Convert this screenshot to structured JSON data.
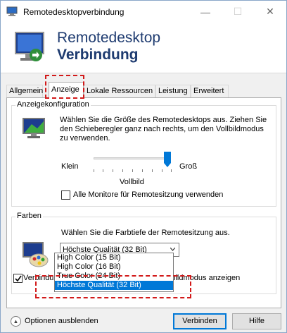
{
  "window": {
    "title": "Remotedesktopverbindung",
    "minimize": "—",
    "maximize": "☐",
    "close": "✕"
  },
  "banner": {
    "line1": "Remotedesktop",
    "line2": "Verbindung"
  },
  "tabs": [
    {
      "label": "Allgemein",
      "active": false
    },
    {
      "label": "Anzeige",
      "active": true
    },
    {
      "label": "Lokale Ressourcen",
      "active": false
    },
    {
      "label": "Leistung",
      "active": false
    },
    {
      "label": "Erweitert",
      "active": false
    }
  ],
  "display_config": {
    "legend": "Anzeigekonfiguration",
    "description": "Wählen Sie die Größe des Remotedesktops aus. Ziehen Sie den Schieberegler ganz nach rechts, um den Vollbildmodus zu verwenden.",
    "small_label": "Klein",
    "large_label": "Groß",
    "slider_value_label": "Vollbild",
    "slider_level": 1.0,
    "all_monitors_label": "Alle Monitore für Remotesitzung verwenden",
    "all_monitors_checked": false
  },
  "colors": {
    "legend": "Farben",
    "description": "Wählen Sie die Farbtiefe der Remotesitzung aus.",
    "selected_value": "Höchste Qualität (32 Bit)",
    "options": [
      "High Color (15 Bit)",
      "High Color (16 Bit)",
      "True Color (24 Bit)",
      "Höchste Qualität (32 Bit)"
    ],
    "selected_index": 3
  },
  "connection_bar": {
    "label": "Verbindungsleiste bei Verwendung des Vollbildmodus anzeigen",
    "checked": true
  },
  "footer": {
    "options_label": "Optionen ausblenden",
    "connect_label": "Verbinden",
    "help_label": "Hilfe"
  },
  "accent_colors": {
    "banner_text": "#1e3b70",
    "selection": "#0078d7",
    "annotation": "#d21a1a"
  }
}
